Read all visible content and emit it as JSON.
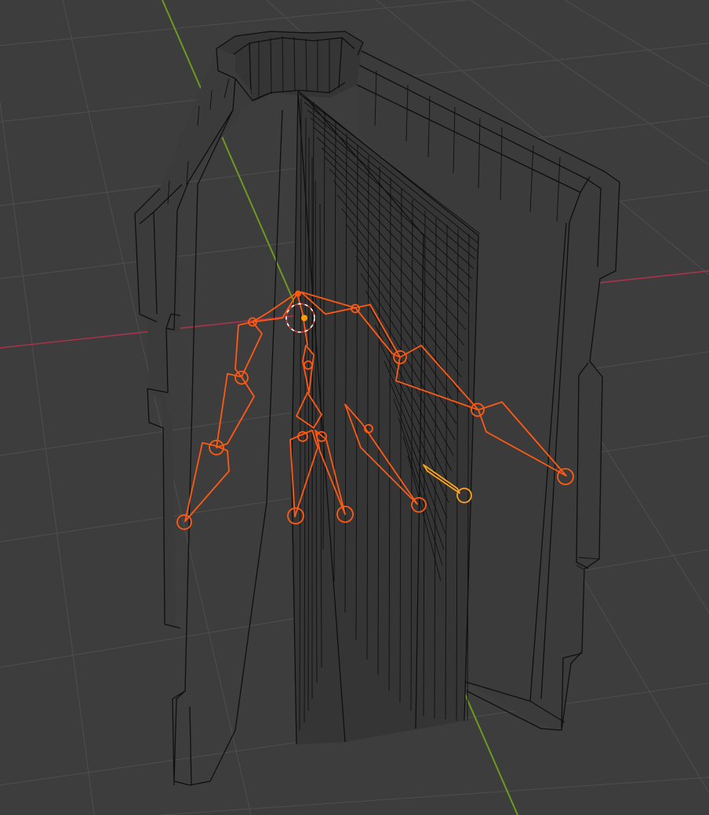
{
  "viewport": {
    "background_color": "#3d3d3d",
    "grid_color": "#4c4c4c",
    "wireframe_color": "#0f0f0f"
  },
  "axes": {
    "x_axis_color": "#a8334a",
    "y_axis_color": "#6d9a1e"
  },
  "armature": {
    "bone_color": "#ff5a14",
    "active_bone_color": "#ffa31a",
    "origin_color": "#ff9a00",
    "cursor_ring_color": "#ffffff"
  },
  "icons": {
    "cursor": "3d-cursor-icon",
    "origin": "object-origin-icon"
  }
}
